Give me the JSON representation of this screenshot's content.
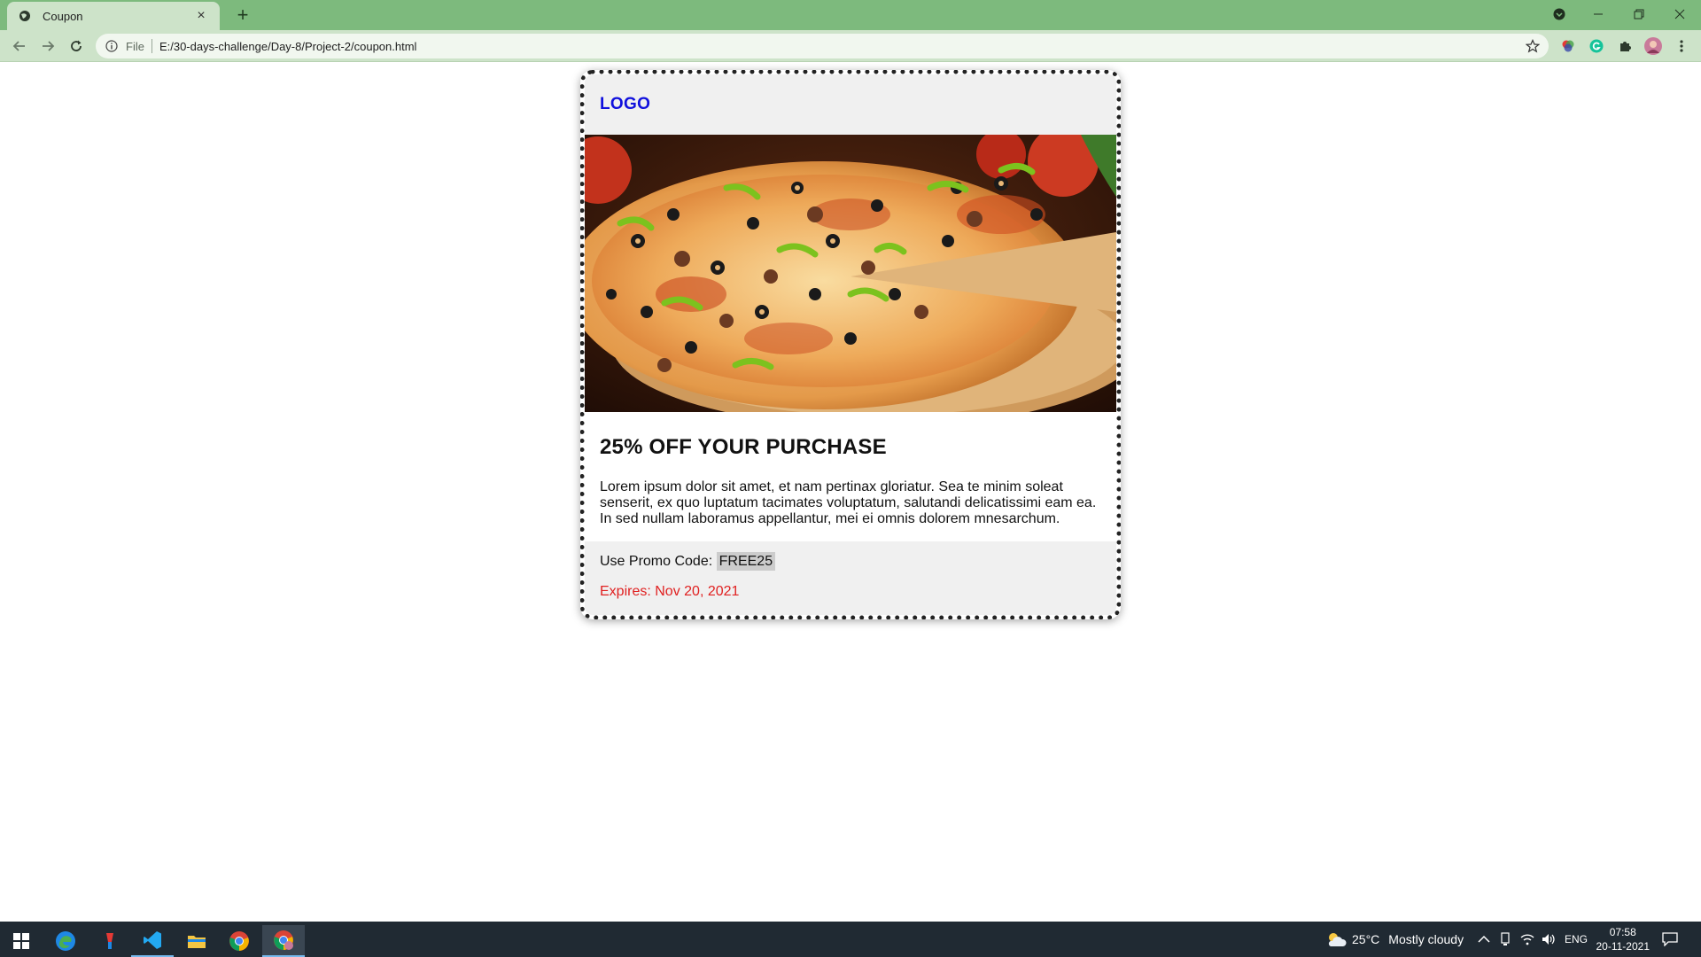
{
  "browser": {
    "tab_title": "Coupon",
    "tab_close": "×",
    "new_tab": "+",
    "address_scheme": "File",
    "address_url": "E:/30-days-challenge/Day-8/Project-2/coupon.html"
  },
  "coupon": {
    "logo": "LOGO",
    "image_alt": "pizza-photo",
    "title": "25% OFF YOUR PURCHASE",
    "description": "Lorem ipsum dolor sit amet, et nam pertinax gloriatur. Sea te minim soleat senserit, ex quo luptatum tacimates voluptatum, salutandi delicatissimi eam ea. In sed nullam laboramus appellantur, mei ei omnis dolorem mnesarchum.",
    "promo_label": "Use Promo Code:",
    "promo_code": "FREE25",
    "expires": "Expires: Nov 20, 2021"
  },
  "taskbar": {
    "weather_temp": "25°C",
    "weather_text": "Mostly cloudy",
    "language": "ENG",
    "time": "07:58",
    "date": "20-11-2021"
  },
  "colors": {
    "tabbar": "#7dba7d",
    "logo": "#1010dd",
    "expires": "#e02020"
  }
}
